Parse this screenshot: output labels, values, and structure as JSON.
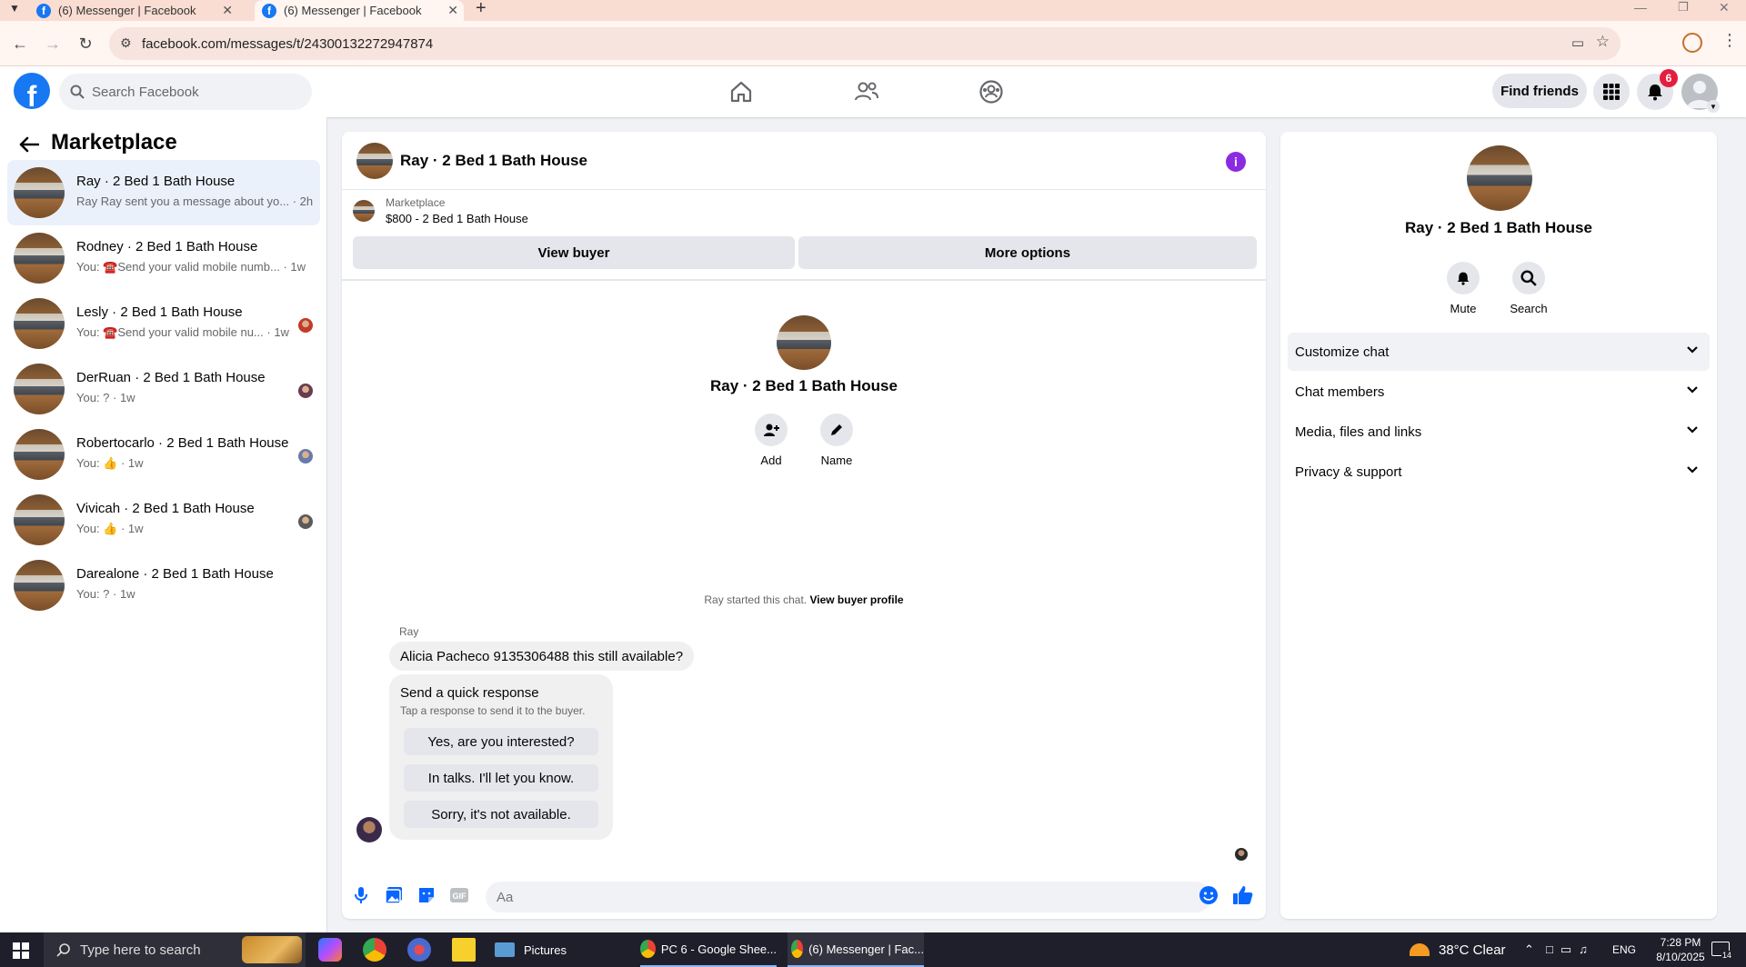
{
  "browser": {
    "tabs": [
      {
        "label": "(6) Messenger | Facebook"
      },
      {
        "label": "(6) Messenger | Facebook"
      }
    ],
    "url": "facebook.com/messages/t/24300132272947874"
  },
  "fb_header": {
    "logo": "f",
    "search_placeholder": "Search Facebook",
    "find_friends": "Find friends",
    "notification_count": "6"
  },
  "left": {
    "title": "Marketplace",
    "conversations": [
      {
        "name": "Ray · 2 Bed 1 Bath House",
        "snippet": "Ray Ray sent you a message about yo... · 2h"
      },
      {
        "name": "Rodney · 2 Bed 1 Bath House",
        "snippet": "You: ☎️Send your valid mobile numb... · 1w"
      },
      {
        "name": "Lesly · 2 Bed 1 Bath House",
        "snippet": "You: ☎️Send your valid mobile nu... · 1w"
      },
      {
        "name": "DerRuan · 2 Bed 1 Bath House",
        "snippet": "You: ? · 1w"
      },
      {
        "name": "Robertocarlo · 2 Bed 1 Bath House",
        "snippet": "You: 👍 · 1w"
      },
      {
        "name": "Vivicah · 2 Bed 1 Bath House",
        "snippet": "You: 👍 · 1w"
      },
      {
        "name": "Darealone · 2 Bed 1 Bath House",
        "snippet": "You: ? · 1w"
      }
    ]
  },
  "chat": {
    "title": "Ray · 2 Bed 1 Bath House",
    "listing_label": "Marketplace",
    "listing_price": "$800 - 2 Bed 1 Bath House",
    "view_buyer": "View buyer",
    "more_options": "More options",
    "profile_name": "Ray · 2 Bed 1 Bath House",
    "add_label": "Add",
    "name_label": "Name",
    "started_text": "Ray started this chat.",
    "view_buyer_profile": "View buyer profile",
    "sender": "Ray",
    "message": "Alicia Pacheco 9135306488 this still available?",
    "quick_title": "Send a quick response",
    "quick_sub": "Tap a response to send it to the buyer.",
    "quick_responses": [
      "Yes, are you interested?",
      "In talks. I'll let you know.",
      "Sorry, it's not available."
    ],
    "input_placeholder": "Aa"
  },
  "info": {
    "name": "Ray · 2 Bed 1 Bath House",
    "mute": "Mute",
    "search": "Search",
    "sections": [
      "Customize chat",
      "Chat members",
      "Media, files and links",
      "Privacy & support"
    ]
  },
  "taskbar": {
    "search_placeholder": "Type here to search",
    "apps": [
      {
        "label": "Pictures"
      },
      {
        "label": "PC 6 - Google Shee..."
      },
      {
        "label": "(6) Messenger | Fac..."
      }
    ],
    "weather": "38°C  Clear",
    "lang": "ENG",
    "time": "7:28 PM",
    "date": "8/10/2025",
    "notif_count": "14"
  },
  "colors": {
    "fb_blue": "#1877f2",
    "accent_purple": "#8a2be2",
    "active_conv": "#ebf1fb"
  }
}
